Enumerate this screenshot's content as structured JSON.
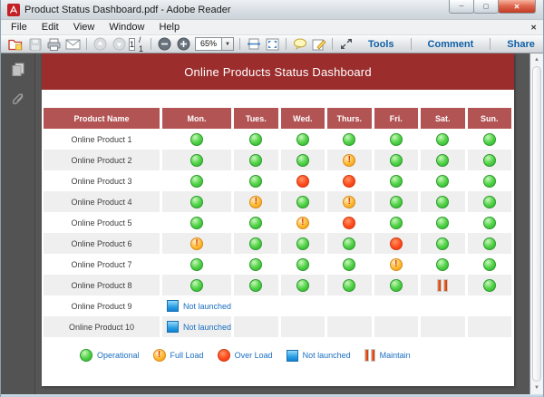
{
  "window": {
    "title": "Product Status Dashboard.pdf - Adobe Reader"
  },
  "menu": {
    "items": [
      "File",
      "Edit",
      "View",
      "Window",
      "Help"
    ]
  },
  "toolbar": {
    "page_current": "1",
    "page_total": "/ 1",
    "zoom_value": "65%",
    "tools_label": "Tools",
    "comment_label": "Comment",
    "share_label": "Share"
  },
  "icons": {
    "minimize": "─",
    "maximize": "▢",
    "close": "✕",
    "menubar_close": "✕",
    "zoom_dropdown": "▼",
    "scroll_up": "▲",
    "scroll_down": "▼"
  },
  "document": {
    "banner_title": "Online Products Status Dashboard",
    "table": {
      "columns": [
        "Product Name",
        "Mon.",
        "Tues.",
        "Wed.",
        "Thurs.",
        "Fri.",
        "Sat.",
        "Sun."
      ],
      "rows": [
        {
          "name": "Online Product 1",
          "statuses": [
            "operational",
            "operational",
            "operational",
            "operational",
            "operational",
            "operational",
            "operational"
          ]
        },
        {
          "name": "Online Product 2",
          "statuses": [
            "operational",
            "operational",
            "operational",
            "full-load",
            "operational",
            "operational",
            "operational"
          ]
        },
        {
          "name": "Online Product 3",
          "statuses": [
            "operational",
            "operational",
            "over-load",
            "over-load",
            "operational",
            "operational",
            "operational"
          ]
        },
        {
          "name": "Online Product 4",
          "statuses": [
            "operational",
            "full-load",
            "operational",
            "full-load",
            "operational",
            "operational",
            "operational"
          ]
        },
        {
          "name": "Online Product 5",
          "statuses": [
            "operational",
            "operational",
            "full-load",
            "over-load",
            "operational",
            "operational",
            "operational"
          ]
        },
        {
          "name": "Online Product 6",
          "statuses": [
            "full-load",
            "operational",
            "operational",
            "operational",
            "over-load",
            "operational",
            "operational"
          ]
        },
        {
          "name": "Online Product 7",
          "statuses": [
            "operational",
            "operational",
            "operational",
            "operational",
            "full-load",
            "operational",
            "operational"
          ]
        },
        {
          "name": "Online Product 8",
          "statuses": [
            "operational",
            "operational",
            "operational",
            "operational",
            "operational",
            "maintain",
            "operational"
          ]
        },
        {
          "name": "Online Product 9",
          "not_launched": true,
          "label": "Not launched"
        },
        {
          "name": "Online Product 10",
          "not_launched": true,
          "label": "Not launched"
        }
      ]
    },
    "legend": [
      {
        "type": "operational",
        "label": "Operational"
      },
      {
        "type": "full-load",
        "label": "Full Load"
      },
      {
        "type": "over-load",
        "label": "Over Load"
      },
      {
        "type": "not-launched",
        "label": "Not launched"
      },
      {
        "type": "maintain",
        "label": "Maintain"
      }
    ]
  },
  "colors": {
    "banner_red": "#9b2d2d",
    "header_cell_red": "#b35454",
    "row_stripe": "#efefef",
    "operational_green": "#3fbf3f",
    "full_load_orange": "#fdb92e",
    "over_load_red": "#ef4316",
    "not_launched_blue": "#2a9ee4",
    "maintain_orange": "#e04a12",
    "legend_text_blue": "#1a6fc0",
    "toolbar_label_blue": "#0f5fa6"
  }
}
